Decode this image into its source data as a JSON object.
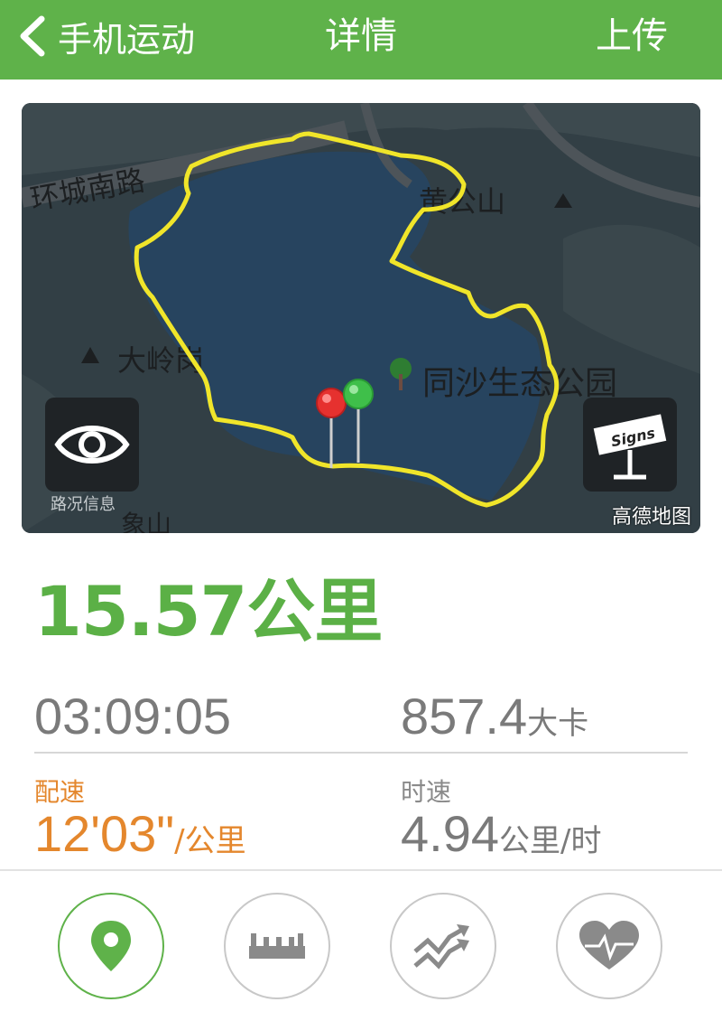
{
  "header": {
    "back_label": "手机运动",
    "title": "详情",
    "upload_label": "上传"
  },
  "map": {
    "labels": [
      "环城南路",
      "黄公山",
      "大岭岗",
      "同沙生态公园",
      "象山"
    ],
    "traffic_caption": "路况信息",
    "provider": "高德地图",
    "signs_text": "Signs",
    "route_color": "#f0e52a",
    "start_pin_color": "#e6312f",
    "end_pin_color": "#3fbf4a"
  },
  "summary": {
    "distance": "15.57公里",
    "duration": "03:09:05",
    "calories_value": "857.4",
    "calories_unit": "大卡",
    "pace_label": "配速",
    "pace_value": "12'03\"",
    "pace_unit": "/公里",
    "speed_label": "时速",
    "speed_value": "4.94",
    "speed_unit": "公里/时"
  },
  "tabs": [
    {
      "icon": "location-pin-icon",
      "active": true
    },
    {
      "icon": "ruler-icon",
      "active": false
    },
    {
      "icon": "trend-arrows-icon",
      "active": false
    },
    {
      "icon": "heartbeat-icon",
      "active": false
    }
  ],
  "colors": {
    "brand_green": "#5fb24a",
    "pace_orange": "#e4872d"
  }
}
